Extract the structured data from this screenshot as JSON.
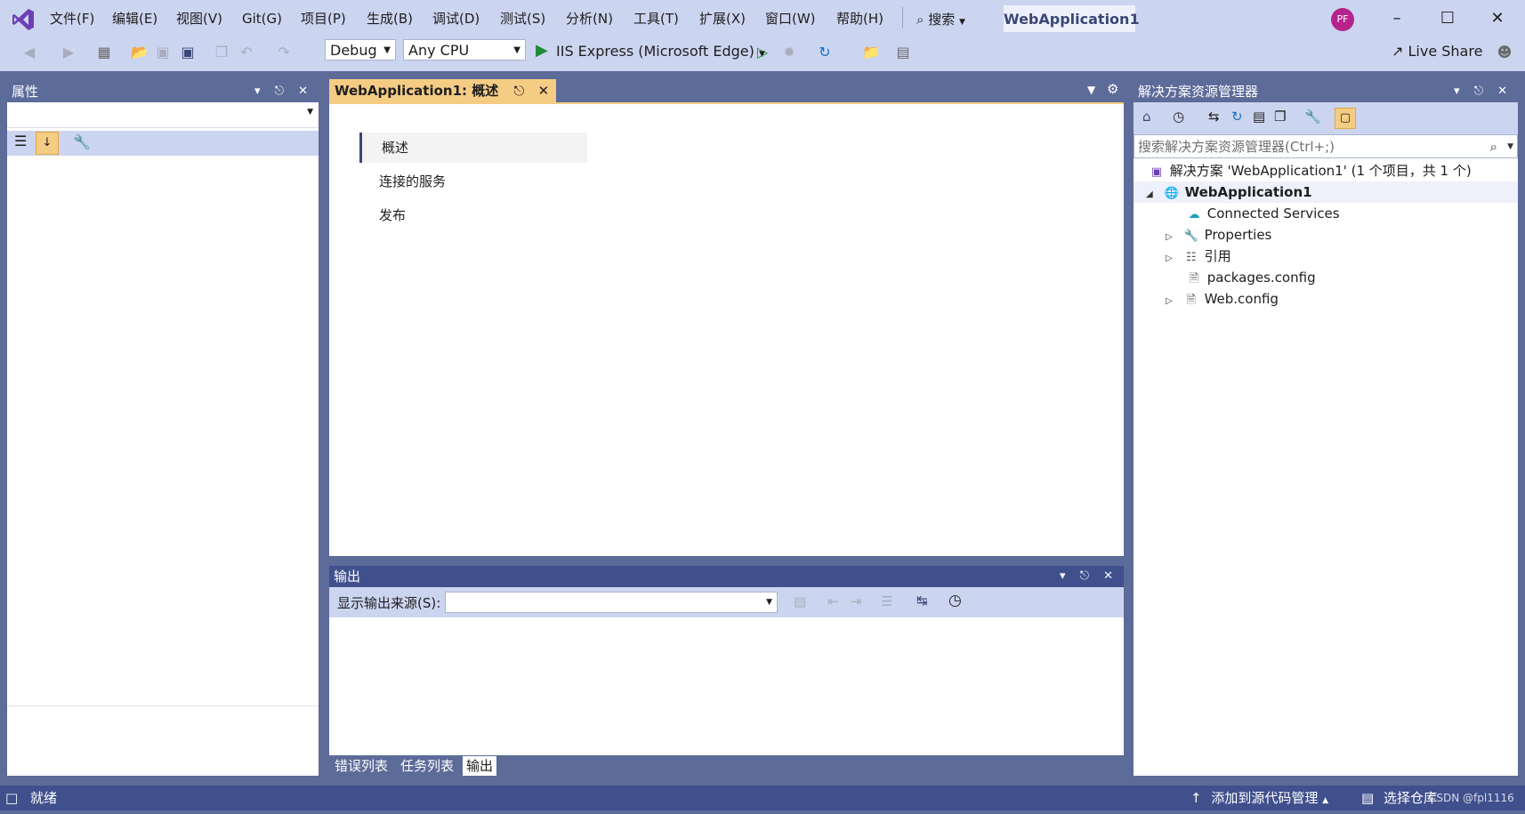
{
  "menu": {
    "items": [
      "文件(F)",
      "编辑(E)",
      "视图(V)",
      "Git(G)",
      "项目(P)",
      "生成(B)",
      "调试(D)",
      "测试(S)",
      "分析(N)",
      "工具(T)",
      "扩展(X)",
      "窗口(W)",
      "帮助(H)"
    ],
    "search_label": "搜索",
    "solution_title": "WebApplication1",
    "avatar_initials": "PF"
  },
  "toolbar": {
    "config": "Debug",
    "platform": "Any CPU",
    "run_target": "IIS Express (Microsoft Edge)",
    "live_share": "Live Share"
  },
  "properties": {
    "title": "属性"
  },
  "document": {
    "tab_title": "WebApplication1: 概述",
    "nav": [
      "概述",
      "连接的服务",
      "发布"
    ]
  },
  "output": {
    "title": "输出",
    "source_label": "显示输出来源(S):",
    "bottom_tabs": [
      "错误列表",
      "任务列表",
      "输出"
    ]
  },
  "solution_explorer": {
    "title": "解决方案资源管理器",
    "search_placeholder": "搜索解决方案资源管理器(Ctrl+;)",
    "solution_node": "解决方案 'WebApplication1' (1 个项目，共 1 个)",
    "project_node": "WebApplication1",
    "children": [
      "Connected Services",
      "Properties",
      "引用",
      "packages.config",
      "Web.config"
    ]
  },
  "status": {
    "text": "就绪",
    "add_source_control": "添加到源代码管理",
    "select_repo": "选择仓库",
    "watermark": "CSDN @fpl1116"
  },
  "colors": {
    "frame": "#5d6b99",
    "header": "#40508d",
    "chrome": "#ccd5f0",
    "tab_accent": "#f5cc84"
  }
}
